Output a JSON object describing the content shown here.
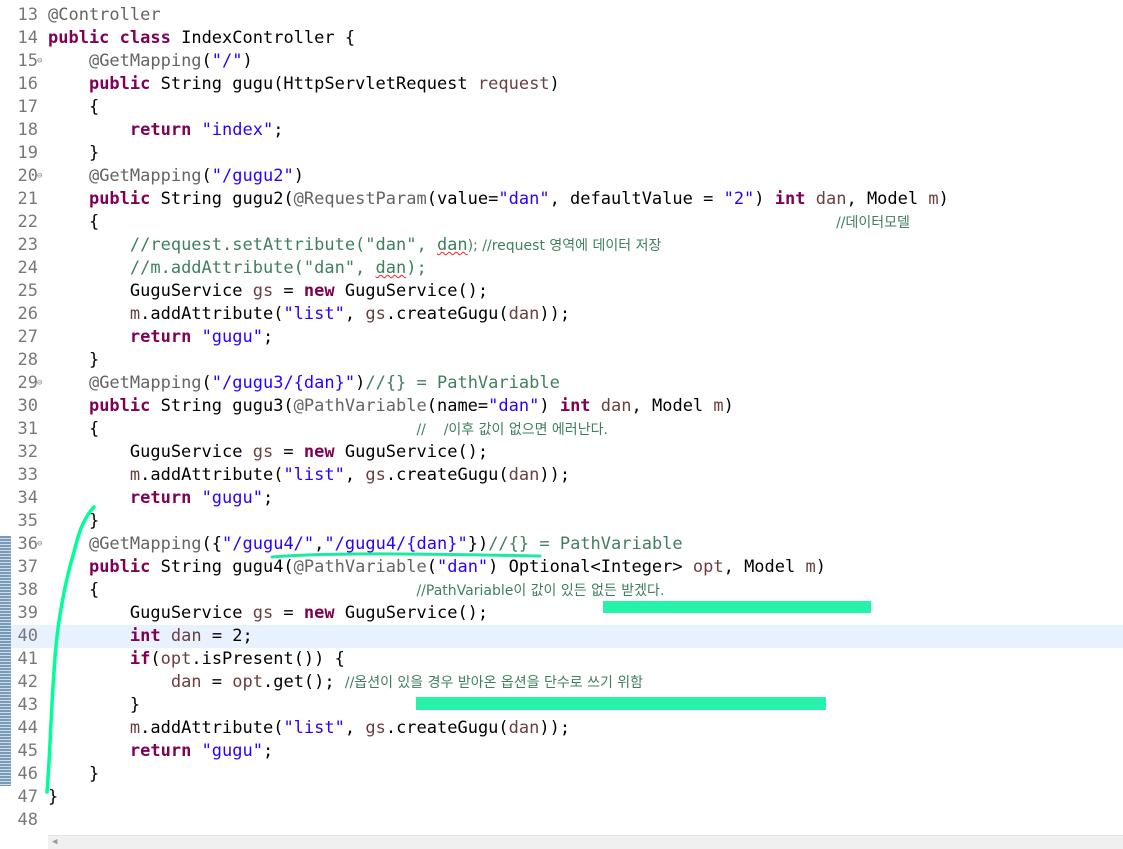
{
  "colors": {
    "keyword": "#7f0055",
    "string": "#2a00ff",
    "annotation": "#646464",
    "comment": "#3f7f5f",
    "variable": "#6a3e3e",
    "line_number": "#787878",
    "current_line": "#e8f2fe",
    "highlighter": "#00ff99"
  },
  "editor": {
    "current_line": 40,
    "lines": [
      {
        "n": "13",
        "fold": false,
        "tokens": [
          {
            "t": "ann",
            "v": "@Controller"
          }
        ]
      },
      {
        "n": "14",
        "fold": false,
        "tokens": [
          {
            "t": "kw",
            "v": "public"
          },
          {
            "t": "",
            "v": " "
          },
          {
            "t": "kw",
            "v": "class"
          },
          {
            "t": "",
            "v": " IndexController {"
          }
        ]
      },
      {
        "n": "15",
        "fold": true,
        "tokens": [
          {
            "t": "",
            "v": "    "
          },
          {
            "t": "ann",
            "v": "@GetMapping"
          },
          {
            "t": "",
            "v": "("
          },
          {
            "t": "str",
            "v": "\"/\""
          },
          {
            "t": "",
            "v": ")"
          }
        ]
      },
      {
        "n": "16",
        "fold": false,
        "tokens": [
          {
            "t": "",
            "v": "    "
          },
          {
            "t": "kw",
            "v": "public"
          },
          {
            "t": "",
            "v": " String gugu(HttpServletRequest "
          },
          {
            "t": "var",
            "v": "request"
          },
          {
            "t": "",
            "v": ")"
          }
        ]
      },
      {
        "n": "17",
        "fold": false,
        "tokens": [
          {
            "t": "",
            "v": "    {"
          }
        ]
      },
      {
        "n": "18",
        "fold": false,
        "tokens": [
          {
            "t": "",
            "v": "        "
          },
          {
            "t": "kw",
            "v": "return"
          },
          {
            "t": "",
            "v": " "
          },
          {
            "t": "str",
            "v": "\"index\""
          },
          {
            "t": "",
            "v": ";"
          }
        ]
      },
      {
        "n": "19",
        "fold": false,
        "tokens": [
          {
            "t": "",
            "v": "    }"
          }
        ]
      },
      {
        "n": "20",
        "fold": true,
        "tokens": [
          {
            "t": "",
            "v": "    "
          },
          {
            "t": "ann",
            "v": "@GetMapping"
          },
          {
            "t": "",
            "v": "("
          },
          {
            "t": "str",
            "v": "\"/gugu2\""
          },
          {
            "t": "",
            "v": ")"
          }
        ]
      },
      {
        "n": "21",
        "fold": false,
        "tokens": [
          {
            "t": "",
            "v": "    "
          },
          {
            "t": "kw",
            "v": "public"
          },
          {
            "t": "",
            "v": " String gugu2("
          },
          {
            "t": "ann",
            "v": "@RequestParam"
          },
          {
            "t": "",
            "v": "(value="
          },
          {
            "t": "str",
            "v": "\"dan\""
          },
          {
            "t": "",
            "v": ", defaultValue = "
          },
          {
            "t": "str",
            "v": "\"2\""
          },
          {
            "t": "",
            "v": ") "
          },
          {
            "t": "kw",
            "v": "int"
          },
          {
            "t": "",
            "v": " "
          },
          {
            "t": "var",
            "v": "dan"
          },
          {
            "t": "",
            "v": ", Model "
          },
          {
            "t": "var",
            "v": "m"
          },
          {
            "t": "",
            "v": ")"
          }
        ]
      },
      {
        "n": "22",
        "fold": false,
        "tokens": [
          {
            "t": "",
            "v": "    {                                                                        "
          },
          {
            "t": "cm",
            "v": "//데이터모델"
          }
        ]
      },
      {
        "n": "23",
        "fold": false,
        "tokens": [
          {
            "t": "",
            "v": "        "
          },
          {
            "t": "cm",
            "v": "//request.setAttribute(\"dan\", "
          },
          {
            "t": "cmsq",
            "v": "dan"
          },
          {
            "t": "cm",
            "v": "); //request 영역에 데이터 저장"
          }
        ]
      },
      {
        "n": "24",
        "fold": false,
        "tokens": [
          {
            "t": "",
            "v": "        "
          },
          {
            "t": "cm",
            "v": "//m.addAttribute(\"dan\", "
          },
          {
            "t": "cmsq",
            "v": "dan"
          },
          {
            "t": "cm",
            "v": ");"
          }
        ]
      },
      {
        "n": "25",
        "fold": false,
        "tokens": [
          {
            "t": "",
            "v": "        GuguService "
          },
          {
            "t": "var",
            "v": "gs"
          },
          {
            "t": "",
            "v": " = "
          },
          {
            "t": "kw",
            "v": "new"
          },
          {
            "t": "",
            "v": " GuguService();"
          }
        ]
      },
      {
        "n": "26",
        "fold": false,
        "tokens": [
          {
            "t": "",
            "v": "        "
          },
          {
            "t": "var",
            "v": "m"
          },
          {
            "t": "",
            "v": ".addAttribute("
          },
          {
            "t": "str",
            "v": "\"list\""
          },
          {
            "t": "",
            "v": ", "
          },
          {
            "t": "var",
            "v": "gs"
          },
          {
            "t": "",
            "v": ".createGugu("
          },
          {
            "t": "var",
            "v": "dan"
          },
          {
            "t": "",
            "v": "));"
          }
        ]
      },
      {
        "n": "27",
        "fold": false,
        "tokens": [
          {
            "t": "",
            "v": "        "
          },
          {
            "t": "kw",
            "v": "return"
          },
          {
            "t": "",
            "v": " "
          },
          {
            "t": "str",
            "v": "\"gugu\""
          },
          {
            "t": "",
            "v": ";"
          }
        ]
      },
      {
        "n": "28",
        "fold": false,
        "tokens": [
          {
            "t": "",
            "v": "    }"
          }
        ]
      },
      {
        "n": "29",
        "fold": true,
        "tokens": [
          {
            "t": "",
            "v": "    "
          },
          {
            "t": "ann",
            "v": "@GetMapping"
          },
          {
            "t": "",
            "v": "("
          },
          {
            "t": "str",
            "v": "\"/gugu3/{dan}\""
          },
          {
            "t": "",
            "v": ")"
          },
          {
            "t": "cm",
            "v": "//{} = PathVariable"
          }
        ]
      },
      {
        "n": "30",
        "fold": false,
        "tokens": [
          {
            "t": "",
            "v": "    "
          },
          {
            "t": "kw",
            "v": "public"
          },
          {
            "t": "",
            "v": " String gugu3("
          },
          {
            "t": "ann",
            "v": "@PathVariable"
          },
          {
            "t": "",
            "v": "(name="
          },
          {
            "t": "str",
            "v": "\"dan\""
          },
          {
            "t": "",
            "v": ") "
          },
          {
            "t": "kw",
            "v": "int"
          },
          {
            "t": "",
            "v": " "
          },
          {
            "t": "var",
            "v": "dan"
          },
          {
            "t": "",
            "v": ", Model "
          },
          {
            "t": "var",
            "v": "m"
          },
          {
            "t": "",
            "v": ")"
          }
        ]
      },
      {
        "n": "31",
        "fold": false,
        "tokens": [
          {
            "t": "",
            "v": "    {                               "
          },
          {
            "t": "cm",
            "v": "//    /이후 값이 없으면 에러난다."
          }
        ]
      },
      {
        "n": "32",
        "fold": false,
        "tokens": [
          {
            "t": "",
            "v": "        GuguService "
          },
          {
            "t": "var",
            "v": "gs"
          },
          {
            "t": "",
            "v": " = "
          },
          {
            "t": "kw",
            "v": "new"
          },
          {
            "t": "",
            "v": " GuguService();"
          }
        ]
      },
      {
        "n": "33",
        "fold": false,
        "tokens": [
          {
            "t": "",
            "v": "        "
          },
          {
            "t": "var",
            "v": "m"
          },
          {
            "t": "",
            "v": ".addAttribute("
          },
          {
            "t": "str",
            "v": "\"list\""
          },
          {
            "t": "",
            "v": ", "
          },
          {
            "t": "var",
            "v": "gs"
          },
          {
            "t": "",
            "v": ".createGugu("
          },
          {
            "t": "var",
            "v": "dan"
          },
          {
            "t": "",
            "v": "));"
          }
        ]
      },
      {
        "n": "34",
        "fold": false,
        "tokens": [
          {
            "t": "",
            "v": "        "
          },
          {
            "t": "kw",
            "v": "return"
          },
          {
            "t": "",
            "v": " "
          },
          {
            "t": "str",
            "v": "\"gugu\""
          },
          {
            "t": "",
            "v": ";"
          }
        ]
      },
      {
        "n": "35",
        "fold": false,
        "tokens": [
          {
            "t": "",
            "v": "    }"
          }
        ]
      },
      {
        "n": "36",
        "fold": true,
        "tokens": [
          {
            "t": "",
            "v": "    "
          },
          {
            "t": "ann",
            "v": "@GetMapping"
          },
          {
            "t": "",
            "v": "({"
          },
          {
            "t": "str",
            "v": "\"/gugu4/\""
          },
          {
            "t": "",
            "v": ","
          },
          {
            "t": "str",
            "v": "\"/gugu4/{dan}\""
          },
          {
            "t": "",
            "v": "})"
          },
          {
            "t": "cm",
            "v": "//{} = PathVariable"
          }
        ]
      },
      {
        "n": "37",
        "fold": false,
        "tokens": [
          {
            "t": "",
            "v": "    "
          },
          {
            "t": "kw",
            "v": "public"
          },
          {
            "t": "",
            "v": " String gugu4("
          },
          {
            "t": "ann",
            "v": "@PathVariable"
          },
          {
            "t": "",
            "v": "("
          },
          {
            "t": "str",
            "v": "\"dan\""
          },
          {
            "t": "",
            "v": ") Optional<Integer> "
          },
          {
            "t": "var",
            "v": "opt"
          },
          {
            "t": "",
            "v": ", Model "
          },
          {
            "t": "var",
            "v": "m"
          },
          {
            "t": "",
            "v": ")"
          }
        ]
      },
      {
        "n": "38",
        "fold": false,
        "tokens": [
          {
            "t": "",
            "v": "    {                               "
          },
          {
            "t": "cm",
            "v": "//PathVariable이 값이 있든 없든 받겠다."
          }
        ]
      },
      {
        "n": "39",
        "fold": false,
        "tokens": [
          {
            "t": "",
            "v": "        GuguService "
          },
          {
            "t": "var",
            "v": "gs"
          },
          {
            "t": "",
            "v": " = "
          },
          {
            "t": "kw",
            "v": "new"
          },
          {
            "t": "",
            "v": " GuguService();"
          }
        ]
      },
      {
        "n": "40",
        "fold": false,
        "tokens": [
          {
            "t": "",
            "v": "        "
          },
          {
            "t": "kw",
            "v": "int"
          },
          {
            "t": "",
            "v": " "
          },
          {
            "t": "var",
            "v": "dan"
          },
          {
            "t": "",
            "v": " = 2;"
          }
        ]
      },
      {
        "n": "41",
        "fold": false,
        "tokens": [
          {
            "t": "",
            "v": "        "
          },
          {
            "t": "kw",
            "v": "if"
          },
          {
            "t": "",
            "v": "("
          },
          {
            "t": "var",
            "v": "opt"
          },
          {
            "t": "",
            "v": ".isPresent()) {"
          }
        ]
      },
      {
        "n": "42",
        "fold": false,
        "tokens": [
          {
            "t": "",
            "v": "            "
          },
          {
            "t": "var",
            "v": "dan"
          },
          {
            "t": "",
            "v": " = "
          },
          {
            "t": "var",
            "v": "opt"
          },
          {
            "t": "",
            "v": ".get(); "
          },
          {
            "t": "cm",
            "v": "//옵션이 있을 경우 받아온 옵션을 단수로 쓰기 위함"
          }
        ]
      },
      {
        "n": "43",
        "fold": false,
        "tokens": [
          {
            "t": "",
            "v": "        }"
          }
        ]
      },
      {
        "n": "44",
        "fold": false,
        "tokens": [
          {
            "t": "",
            "v": "        "
          },
          {
            "t": "var",
            "v": "m"
          },
          {
            "t": "",
            "v": ".addAttribute("
          },
          {
            "t": "str",
            "v": "\"list\""
          },
          {
            "t": "",
            "v": ", "
          },
          {
            "t": "var",
            "v": "gs"
          },
          {
            "t": "",
            "v": ".createGugu("
          },
          {
            "t": "var",
            "v": "dan"
          },
          {
            "t": "",
            "v": "));"
          }
        ]
      },
      {
        "n": "45",
        "fold": false,
        "tokens": [
          {
            "t": "",
            "v": "        "
          },
          {
            "t": "kw",
            "v": "return"
          },
          {
            "t": "",
            "v": " "
          },
          {
            "t": "str",
            "v": "\"gugu\""
          },
          {
            "t": "",
            "v": ";"
          }
        ]
      },
      {
        "n": "46",
        "fold": false,
        "tokens": [
          {
            "t": "",
            "v": "    }"
          }
        ]
      },
      {
        "n": "47",
        "fold": false,
        "tokens": [
          {
            "t": "",
            "v": "}"
          }
        ]
      },
      {
        "n": "48",
        "fold": false,
        "tokens": []
      }
    ]
  },
  "scrollbar": {
    "left_arrow_icon": "◀"
  }
}
